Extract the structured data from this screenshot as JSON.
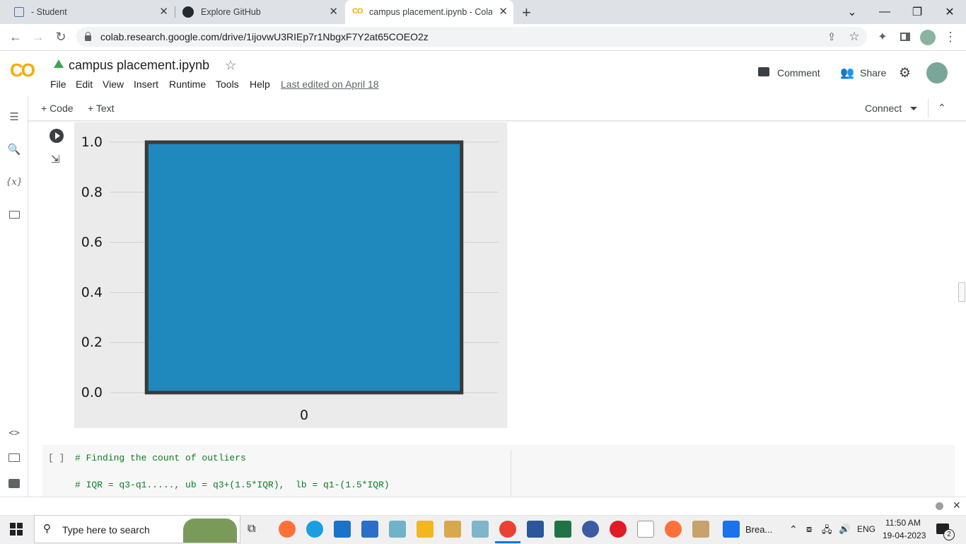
{
  "browser": {
    "tabs": [
      {
        "title": "- Student"
      },
      {
        "title": "Explore GitHub"
      },
      {
        "title": "campus placement.ipynb - Colab"
      }
    ],
    "url": "colab.research.google.com/drive/1ijovwU3RIEp7r1NbgxF7Y2at65COEO2z"
  },
  "colab": {
    "logo": "CO",
    "notebook_title": "campus placement.ipynb",
    "menu": [
      "File",
      "Edit",
      "View",
      "Insert",
      "Runtime",
      "Tools",
      "Help"
    ],
    "last_edited": "Last edited on April 18",
    "comment_label": "Comment",
    "share_label": "Share",
    "toolbar": {
      "code_label": "+ Code",
      "text_label": "+ Text",
      "connect_label": "Connect"
    }
  },
  "chart_data": {
    "type": "bar",
    "categories": [
      "0"
    ],
    "values": [
      1.0
    ],
    "ylim": [
      0,
      1.0
    ],
    "yticks": [
      "0.0",
      "0.2",
      "0.4",
      "0.6",
      "0.8",
      "1.0"
    ],
    "grid": true,
    "colors": {
      "bar": "#1f88bd",
      "edge": "#3a3a3a",
      "background": "#ebebeb",
      "grid": "#ffffff"
    }
  },
  "code_cell": {
    "prompt": "[ ]",
    "lines": [
      "# Finding the count of outliers",
      "# IQR = q3-q1....., ub = q3+(1.5*IQR),  lb = q1-(1.5*IQR)"
    ]
  },
  "taskbar": {
    "search_placeholder": "Type here to search",
    "app_label": "Brea...",
    "language": "ENG",
    "time": "11:50 AM",
    "date": "19-04-2023",
    "notification_count": "2"
  }
}
